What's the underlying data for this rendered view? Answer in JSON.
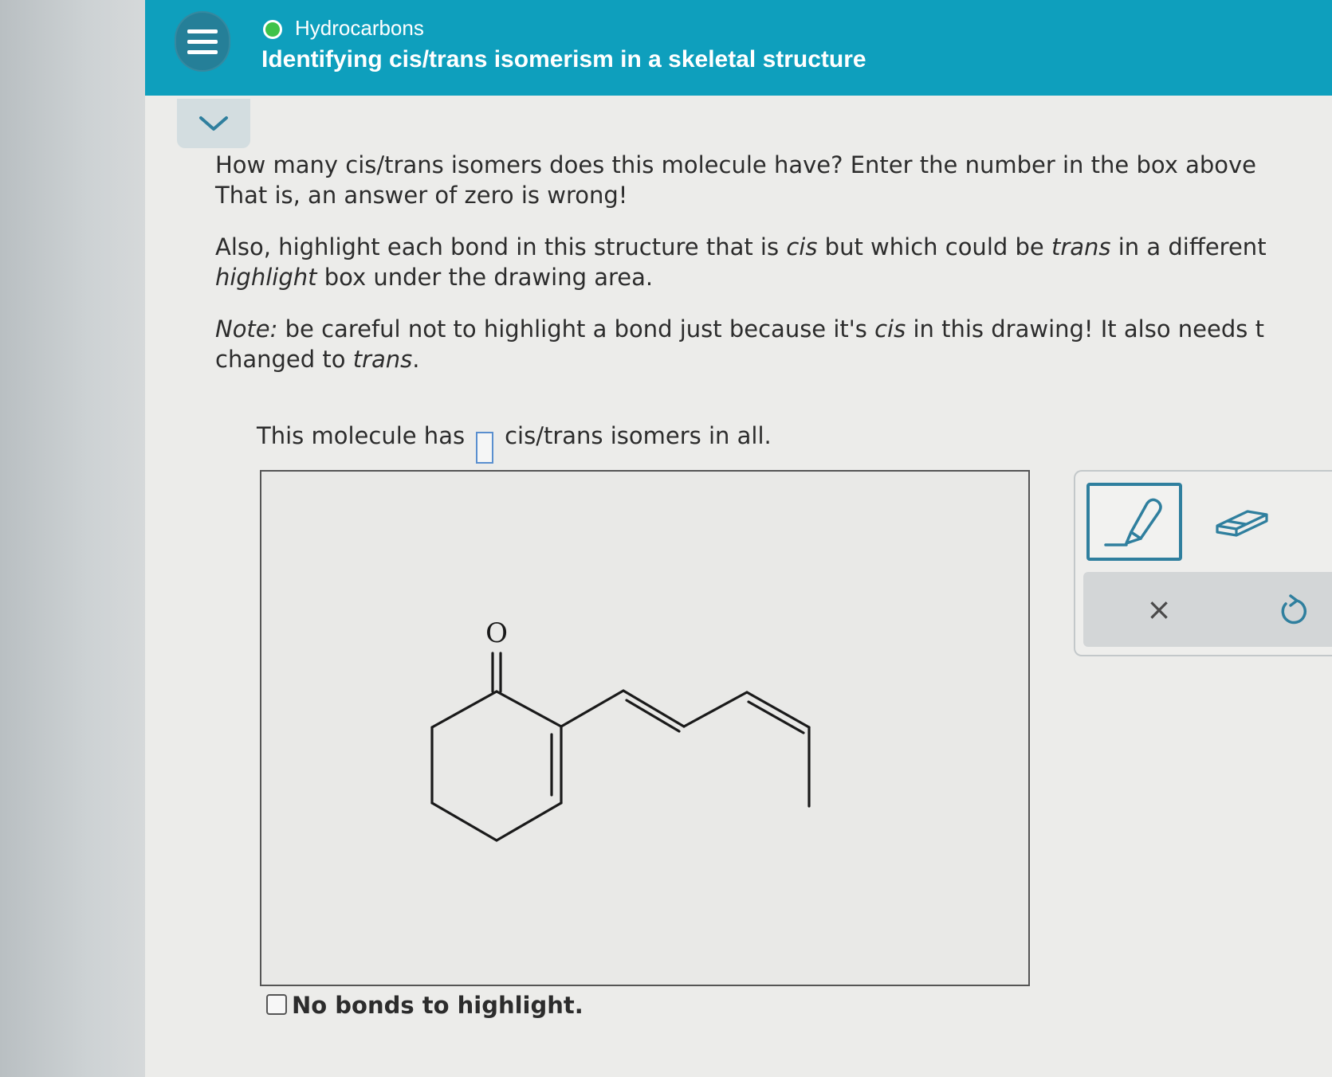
{
  "header": {
    "topic": "Hydrocarbons",
    "title": "Identifying cis/trans isomerism in a skeletal structure"
  },
  "question": {
    "p1_line1": "How many cis/trans isomers does this molecule have? Enter the number in the box above",
    "p1_line2": "That is, an answer of zero is wrong!",
    "p2_line1_a": "Also, highlight each bond in this structure that is ",
    "p2_line1_cis": "cis",
    "p2_line1_b": " but which could be ",
    "p2_line1_trans": "trans",
    "p2_line1_c": " in a different",
    "p2_line2_highlight": "highlight",
    "p2_line2_rest": " box under the drawing area.",
    "p3_line1_note": "Note:",
    "p3_line1_a": " be careful not to highlight a bond just because it's ",
    "p3_line1_cis": "cis",
    "p3_line1_b": " in this drawing! It also needs t",
    "p3_line2_a": "changed to ",
    "p3_line2_trans": "trans",
    "p3_line2_b": "."
  },
  "answer": {
    "prefix": "This molecule has",
    "suffix": "cis/trans isomers in all.",
    "value": ""
  },
  "molecule": {
    "oxygen_label": "O"
  },
  "tools": {
    "highlight": "highlight-tool",
    "eraser": "eraser-tool",
    "clear": "×",
    "undo": "undo"
  },
  "no_bonds_label": "No bonds to highlight.",
  "colors": {
    "header_bg": "#0e9fbd",
    "menu_bg": "#257f98",
    "status_dot": "#3fc24a",
    "tool_border": "#2f7f9e"
  }
}
